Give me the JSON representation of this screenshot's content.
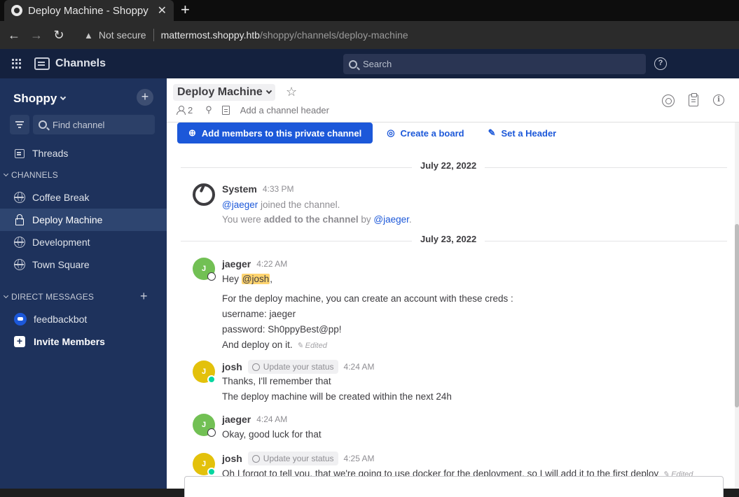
{
  "browser": {
    "tab_title": "Deploy Machine - Shoppy",
    "tab_close": "✕",
    "new_tab": "+",
    "security_label": "Not secure",
    "url_host": "mattermost.shoppy.htb",
    "url_path": "/shoppy/channels/deploy-machine"
  },
  "global_header": {
    "product": "Channels",
    "search_placeholder": "Search",
    "help": "?"
  },
  "sidebar": {
    "team_name": "Shoppy",
    "find_channel": "Find channel",
    "threads": "Threads",
    "channels_section": "CHANNELS",
    "channels": [
      {
        "label": "Coffee Break"
      },
      {
        "label": "Deploy Machine"
      },
      {
        "label": "Development"
      },
      {
        "label": "Town Square"
      }
    ],
    "dm_section": "DIRECT MESSAGES",
    "dms": [
      {
        "label": "feedbackbot"
      }
    ],
    "invite": "Invite Members",
    "active_color": "#2e4570"
  },
  "channel": {
    "name": "Deploy Machine",
    "member_count": "2",
    "header_placeholder": "Add a channel header",
    "add_members": "Add members to this private channel",
    "create_board": "Create a board",
    "set_header": "Set a Header"
  },
  "messages": {
    "date1": "July 22, 2022",
    "date2": "July 23, 2022",
    "system": {
      "author": "System",
      "time": "4:33 PM",
      "line1_mention": "@jaeger",
      "line1_text": "joined the channel.",
      "line2_prefix": "You were",
      "line2_bold": "added to the channel",
      "line2_by": "by",
      "line2_mention": "@jaeger",
      "line2_end": "."
    },
    "post1": {
      "author": "jaeger",
      "avatar_initial": "J",
      "time": "4:22 AM",
      "greeting": "Hey",
      "mention": "@josh",
      "greeting_end": ",",
      "line2": "For the deploy machine, you can create an account with these creds :",
      "line3": "username: jaeger",
      "line4": "password: Sh0ppyBest@pp!",
      "line5": "And deploy on it.",
      "edited": "Edited"
    },
    "post2": {
      "author": "josh",
      "avatar_initial": "J",
      "status_chip": "Update your status",
      "time": "4:24 AM",
      "line1": "Thanks, I'll remember that",
      "line2": "The deploy machine will be created within the next 24h"
    },
    "post3": {
      "author": "jaeger",
      "avatar_initial": "J",
      "time": "4:24 AM",
      "line1": "Okay, good luck for that"
    },
    "post4": {
      "author": "josh",
      "avatar_initial": "J",
      "status_chip": "Update your status",
      "time": "4:25 AM",
      "line1": "Oh I forgot to tell you, that we're going to use docker for the deployment, so I will add it to the first deploy",
      "edited": "Edited"
    }
  },
  "colors": {
    "sidebar_bg": "#1e325c",
    "header_bg": "#14213e",
    "accent": "#1c58d9",
    "mention_highlight": "#ffd470"
  }
}
